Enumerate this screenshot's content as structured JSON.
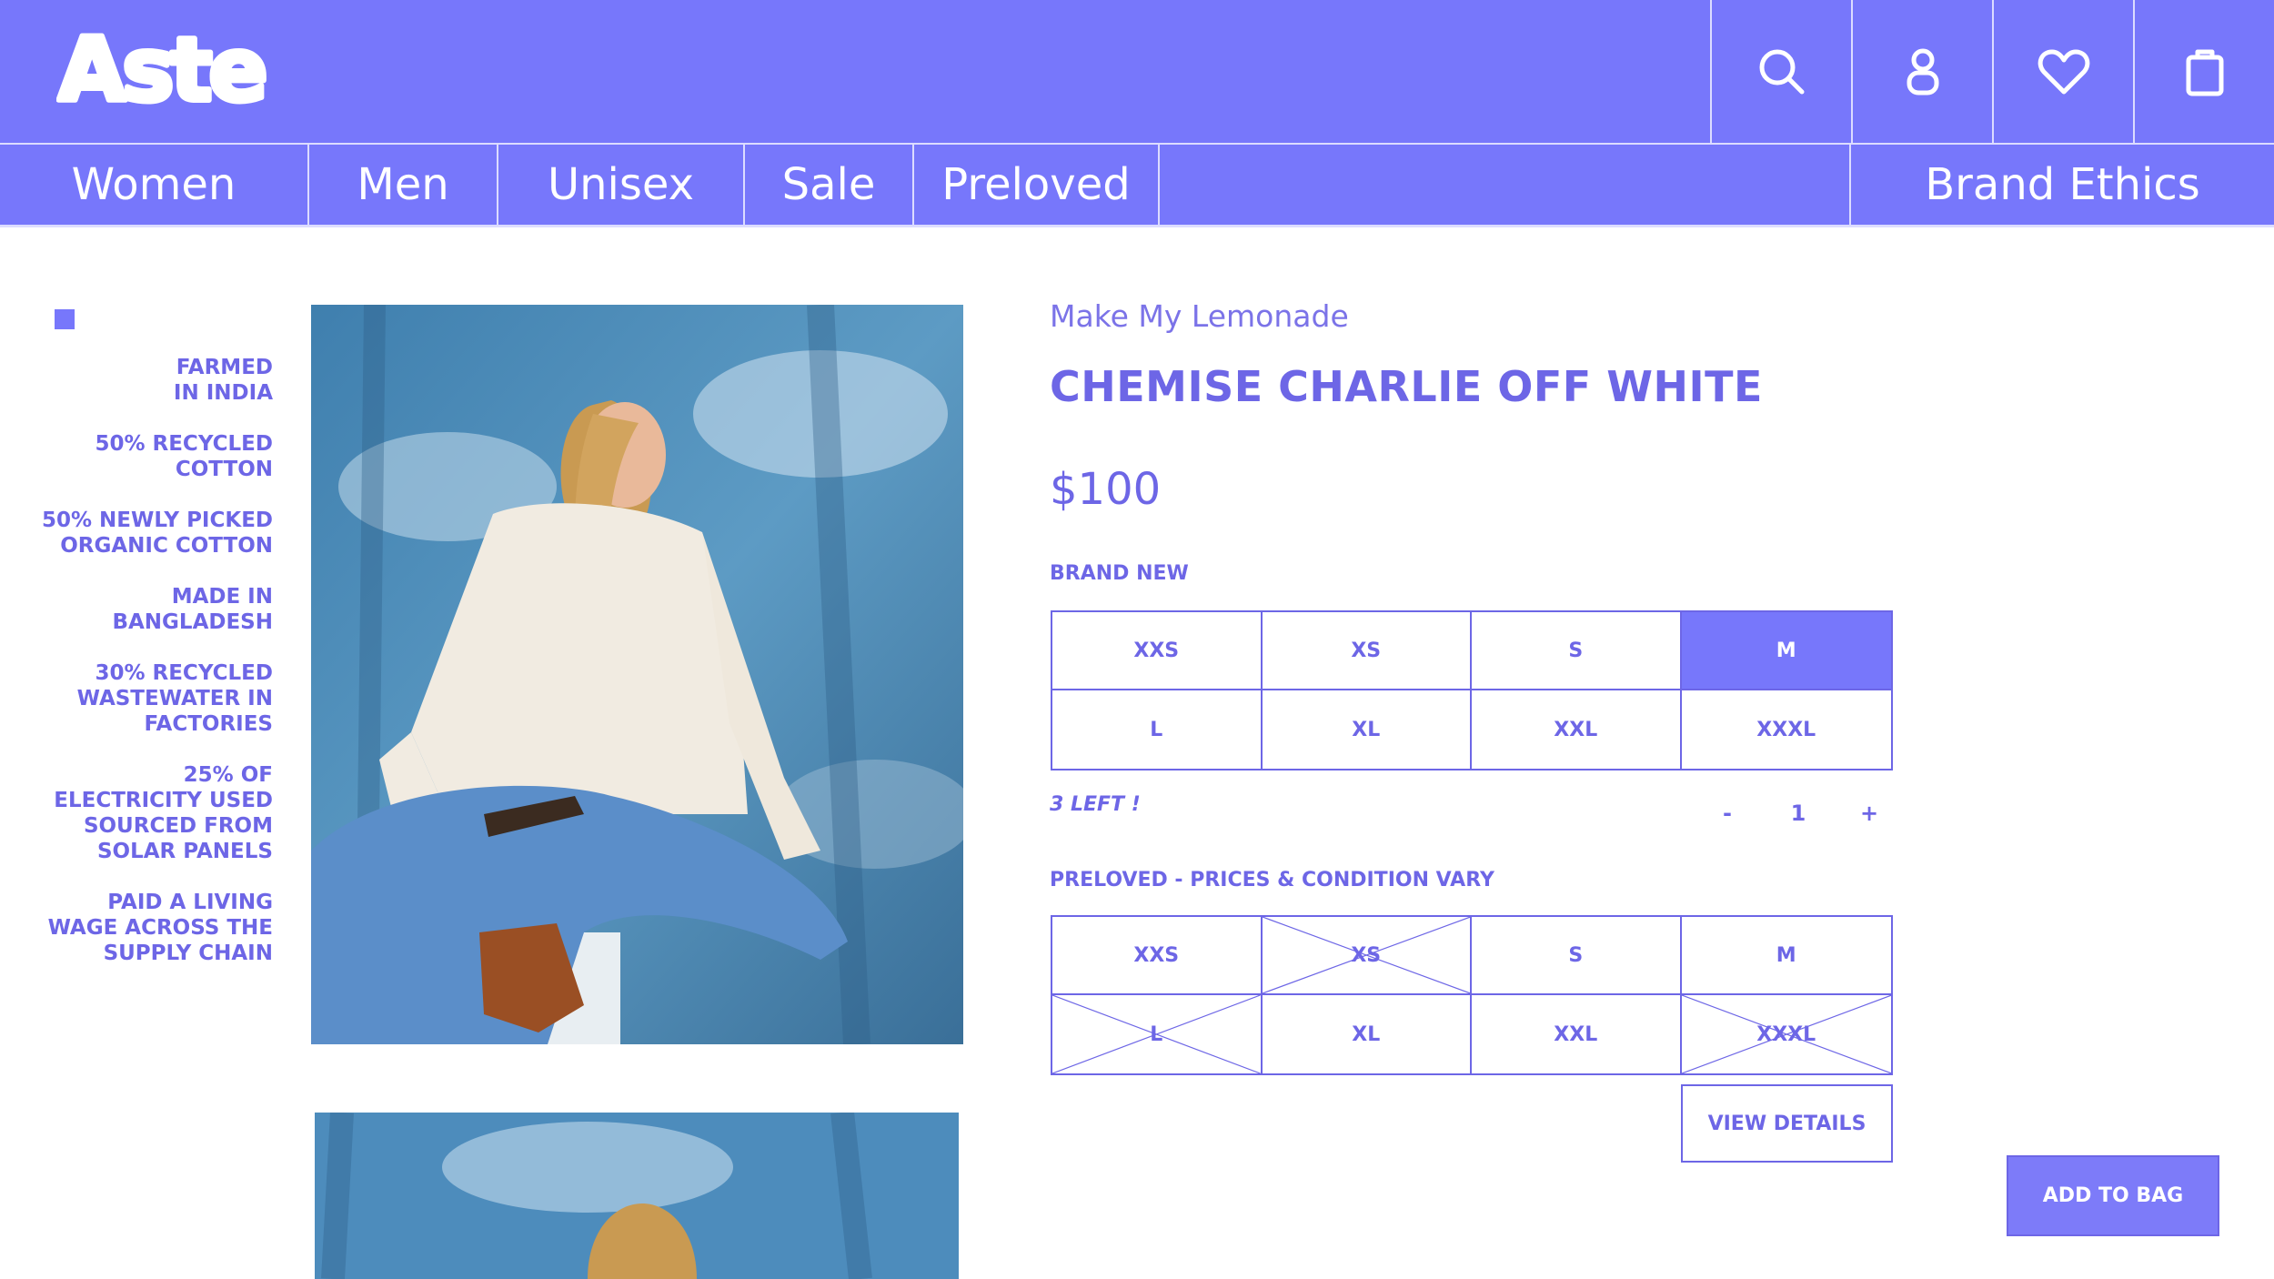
{
  "brand_logo": "Aste",
  "header": {
    "icons": [
      "search-icon",
      "account-icon",
      "heart-icon",
      "bag-icon"
    ]
  },
  "nav": {
    "items": [
      "Women",
      "Men",
      "Unisex",
      "Sale",
      "Preloved"
    ],
    "brand_ethics": "Brand Ethics"
  },
  "facts": [
    "FARMED IN INDIA",
    "50% RECYCLED COTTON",
    "50% NEWLY PICKED ORGANIC COTTON",
    "MADE IN BANGLADESH",
    "30% RECYCLED WASTEWATER IN FACTORIES",
    "25% OF ELECTRICITY USED SOURCED FROM SOLAR PANELS",
    "PAID A LIVING WAGE ACROSS THE SUPPLY CHAIN"
  ],
  "product": {
    "brand": "Make My Lemonade",
    "title": "CHEMISE CHARLIE OFF WHITE",
    "price": "$100"
  },
  "brand_new": {
    "label": "BRAND NEW",
    "sizes": [
      "XXS",
      "XS",
      "S",
      "M",
      "L",
      "XL",
      "XXL",
      "XXXL"
    ],
    "selected": "M",
    "stock": "3 LEFT !",
    "quantity": {
      "minus": "-",
      "value": "1",
      "plus": "+"
    }
  },
  "preloved": {
    "label": "PRELOVED - PRICES & CONDITION VARY",
    "sizes": [
      "XXS",
      "XS",
      "S",
      "M",
      "L",
      "XL",
      "XXL",
      "XXXL"
    ],
    "unavailable": [
      "XS",
      "L",
      "XXXL"
    ],
    "view_details": "VIEW DETAILS"
  },
  "add_to_bag": "ADD TO BAG",
  "colors": {
    "primary": "#7777fb",
    "text": "#6d66e6"
  }
}
